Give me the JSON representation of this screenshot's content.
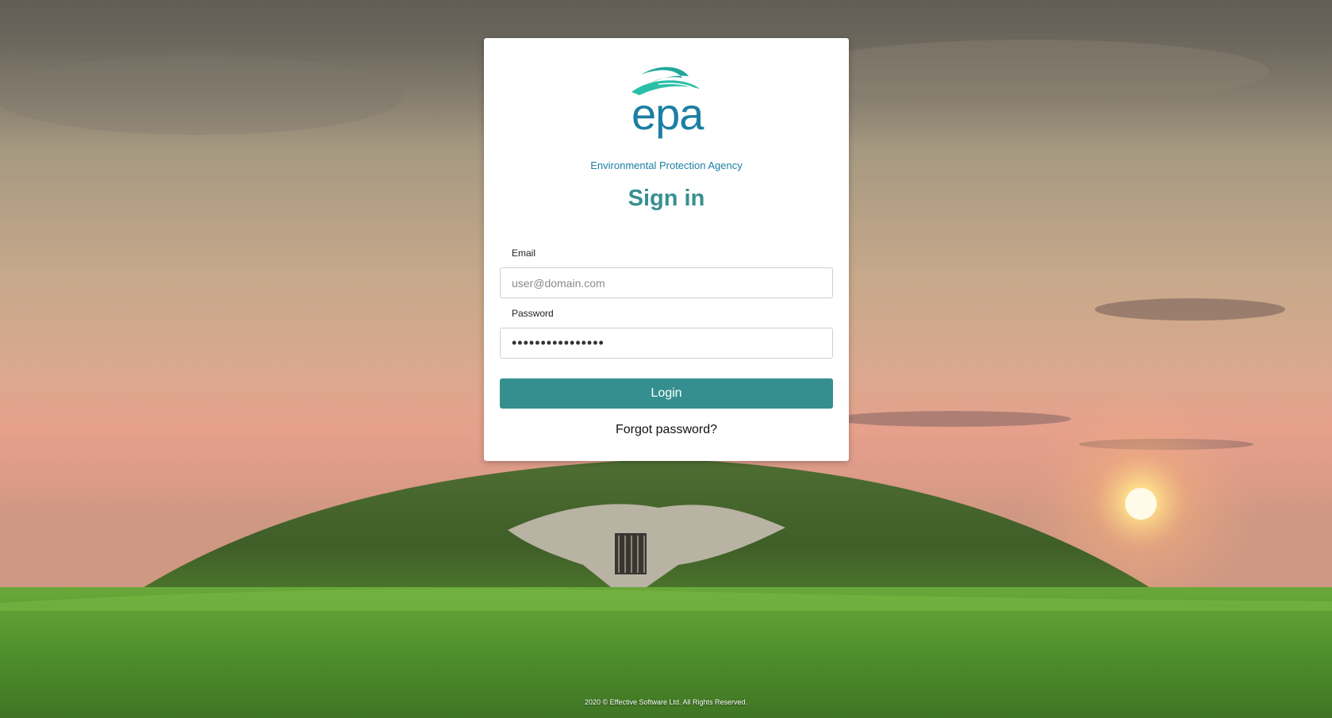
{
  "logo": {
    "word": "epa",
    "subtitle": "Environmental Protection Agency"
  },
  "signin": {
    "title": "Sign in",
    "email_label": "Email",
    "email_placeholder": "user@domain.com",
    "email_value": "",
    "password_label": "Password",
    "password_value": "••••••••••••••••",
    "login_label": "Login",
    "forgot_label": "Forgot password?"
  },
  "footer": {
    "text": "2020 © Effective Software Ltd. All Rights Reserved."
  },
  "colors": {
    "accent": "#358f8f",
    "logo_blue": "#1b7fa3",
    "title_teal": "#388f8f"
  }
}
